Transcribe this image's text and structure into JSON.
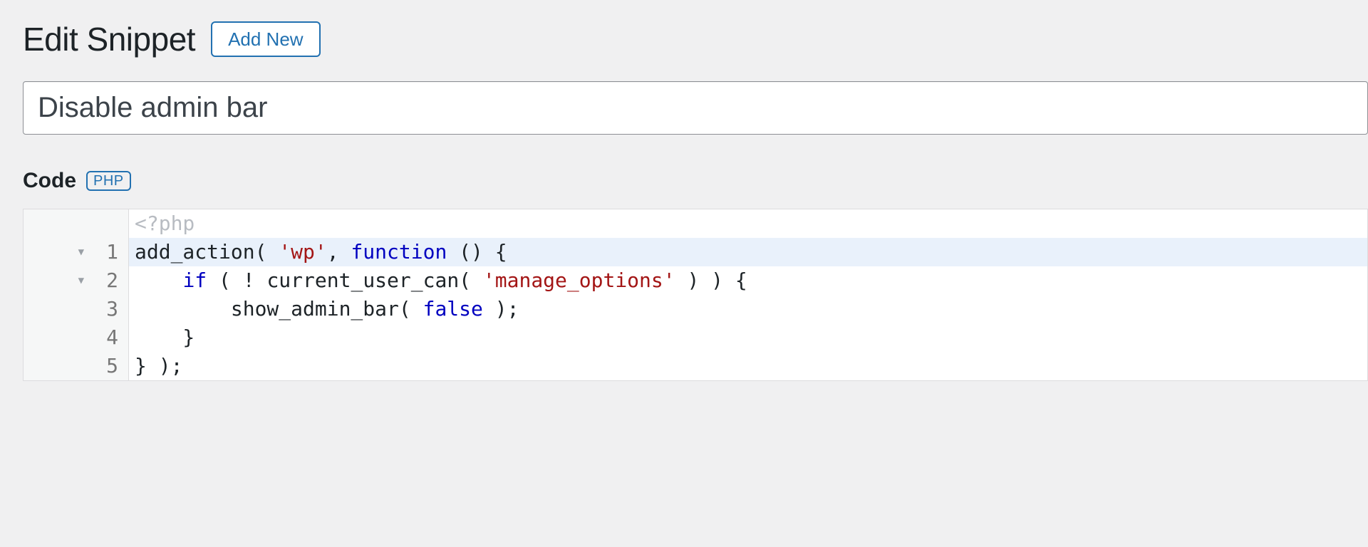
{
  "header": {
    "title": "Edit Snippet",
    "add_new_label": "Add New"
  },
  "snippet": {
    "title_value": "Disable admin bar"
  },
  "code_section": {
    "heading": "Code",
    "lang_badge": "PHP"
  },
  "editor": {
    "placeholder": "<?php",
    "fold_glyph": "▼",
    "lines": [
      {
        "num": "1",
        "foldable": true,
        "active": true,
        "tokens": [
          {
            "t": "add_action",
            "c": "tok-fn"
          },
          {
            "t": "( ",
            "c": "tok-punc"
          },
          {
            "t": "'wp'",
            "c": "tok-str"
          },
          {
            "t": ", ",
            "c": "tok-punc"
          },
          {
            "t": "function",
            "c": "tok-kw"
          },
          {
            "t": " () {",
            "c": "tok-punc"
          }
        ]
      },
      {
        "num": "2",
        "foldable": true,
        "active": false,
        "tokens": [
          {
            "t": "    ",
            "c": "tok-punc"
          },
          {
            "t": "if",
            "c": "tok-kw"
          },
          {
            "t": " ( ! ",
            "c": "tok-punc"
          },
          {
            "t": "current_user_can",
            "c": "tok-fn"
          },
          {
            "t": "( ",
            "c": "tok-punc"
          },
          {
            "t": "'manage_options'",
            "c": "tok-str"
          },
          {
            "t": " ) ) {",
            "c": "tok-punc"
          }
        ]
      },
      {
        "num": "3",
        "foldable": false,
        "active": false,
        "tokens": [
          {
            "t": "        ",
            "c": "tok-punc"
          },
          {
            "t": "show_admin_bar",
            "c": "tok-fn"
          },
          {
            "t": "( ",
            "c": "tok-punc"
          },
          {
            "t": "false",
            "c": "tok-const"
          },
          {
            "t": " );",
            "c": "tok-punc"
          }
        ]
      },
      {
        "num": "4",
        "foldable": false,
        "active": false,
        "tokens": [
          {
            "t": "    }",
            "c": "tok-punc"
          }
        ]
      },
      {
        "num": "5",
        "foldable": false,
        "active": false,
        "tokens": [
          {
            "t": "} );",
            "c": "tok-punc"
          }
        ]
      }
    ]
  }
}
